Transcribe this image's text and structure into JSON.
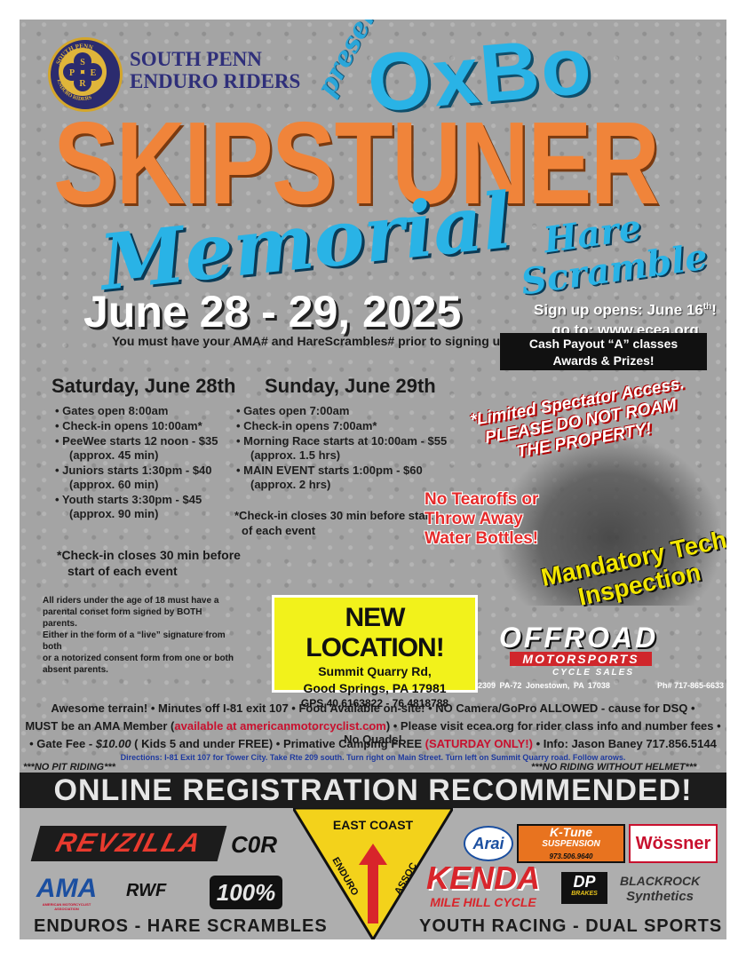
{
  "club": {
    "logo_letters": [
      "S",
      "P",
      "E",
      "R"
    ],
    "logo_ring_top": "SOUTH PENN",
    "logo_ring_bottom": "ENDURO RIDERS",
    "name_line1": "SOUTH PENN",
    "name_line2": "ENDURO RIDERS"
  },
  "title": {
    "presents": "presents",
    "sponsor": "OxBo",
    "name": "SKIPSTUNER",
    "memorial": "Memorial",
    "hare": "Hare",
    "scramble": "Scramble"
  },
  "date": "June 28 - 29, 2025",
  "signup": {
    "line1_prefix": "Sign up opens: June 16",
    "line1_sup": "th",
    "line1_suffix": "!",
    "line2": "go to:  www.ecea.org"
  },
  "requirement": "You must have your AMA# and HareScrambles# prior to signing up online.",
  "payout": {
    "line1": "Cash Payout “A” classes",
    "line2": "Awards & Prizes!"
  },
  "saturday": {
    "heading": "Saturday, June 28th",
    "items": [
      "• Gates open 8:00am",
      "• Check-in opens 10:00am*",
      "• PeeWee starts 12 noon - $35",
      "(approx. 45 min)",
      "• Juniors starts 1:30pm - $40",
      "(approx. 60 min)",
      "• Youth starts 3:30pm - $45",
      "(approx. 90 min)"
    ],
    "note_line1": "*Check-in closes 30 min before",
    "note_line2": "start of each event"
  },
  "sunday": {
    "heading": "Sunday, June 29th",
    "items": [
      "• Gates open 7:00am",
      "• Check-in opens 7:00am*",
      "• Morning Race starts at 10:00am - $55",
      "(approx. 1.5 hrs)",
      "• MAIN EVENT starts 1:00pm - $60",
      "(approx. 2 hrs)"
    ],
    "note_line1": "*Check-in closes 30 min before start",
    "note_line2": "of each event"
  },
  "minors_notice": [
    "All riders under the age of 18 must have a",
    "parental conset form signed by BOTH parents.",
    "Either in the form of a “live” signature from both",
    "or a notorized consent form from one or both",
    "absent parents."
  ],
  "spectator": {
    "line1": "*Limited Spectator Access.",
    "line2": "PLEASE DO NOT ROAM",
    "line3": "THE PROPERTY!"
  },
  "tearoffs": [
    "No Tearoffs or",
    "Throw Away",
    "Water Bottles!"
  ],
  "tech": [
    "Mandatory Tech",
    "Inspection"
  ],
  "location": {
    "heading": "NEW LOCATION!",
    "line1": "Summit Quarry Rd,",
    "line2": "Good Springs, PA 17981",
    "gps": "GPS 40.6163822 - 76.4818788"
  },
  "dealer": {
    "name": "OFFROAD",
    "sub": "MOTORSPORTS",
    "tag": "CYCLE SALES",
    "address": "2309 PA-72 Jonestown, PA 17038",
    "phone": "Ph# 717-865-6633"
  },
  "info": {
    "line1": "Awesome terrain!  •  Minutes off I-81 exit 107  •  Food Available on-site!  •  NO Camera/GoPro ALLOWED - cause for DSQ  •",
    "line2_a": "MUST be an AMA Member (",
    "line2_red": "available at americanmotorcyclist.com",
    "line2_b": ")  •  Please visit ecea.org for rider class info and number fees  •  No Quads!",
    "line3_a": "• Gate Fee - ",
    "line3_fee": "$10.00",
    "line3_b": " ( Kids 5 and under FREE)  •  Primative Camping FREE ",
    "line3_red": "(SATURDAY ONLY!)",
    "line3_c": "  •  Info: Jason Baney  717.856.5144",
    "directions": "Directions: I-81 Exit 107 for Tower City.  Take Rte 209 south. Turn right on Main Street. Turn left on Summit Quarry road. Follow arows.",
    "no_pit": "***NO PIT RIDING***",
    "no_helmet": "***NO RIDING WITHOUT HELMET***"
  },
  "banner": "ONLINE REGISTRATION RECOMMENDED!",
  "sponsors": {
    "revzilla": "REVZILLA",
    "cor": "C0R",
    "arai": "Arai",
    "ktune": "K-Tune",
    "ktune_sub": "SUSPENSION",
    "ktune_phone": "973.506.9640",
    "wossner": "Wössner",
    "ama": "AMA",
    "ama_sub": "AMERICAN MOTORCYCLIST ASSOCIATION",
    "rwf": "RWF",
    "hundred": "100%",
    "east_coast": "EAST COAST",
    "enduro": "ENDURO",
    "assoc": "ASSOC",
    "kenda": "KENDA",
    "mile_hill": "MILE HILL CYCLE",
    "dp": "DP",
    "dp_sub": "BRAKES",
    "blackrock": "BLACKROCK",
    "synthetics": "Synthetics"
  },
  "footer": {
    "left": "ENDUROS - HARE SCRAMBLES",
    "right": "YOUTH RACING - DUAL SPORTS"
  },
  "colors": {
    "orange": "#f0843a",
    "blue": "#29b3e6",
    "navy": "#2f2f7a",
    "yellow": "#f2f21b",
    "red": "#c8102e"
  }
}
